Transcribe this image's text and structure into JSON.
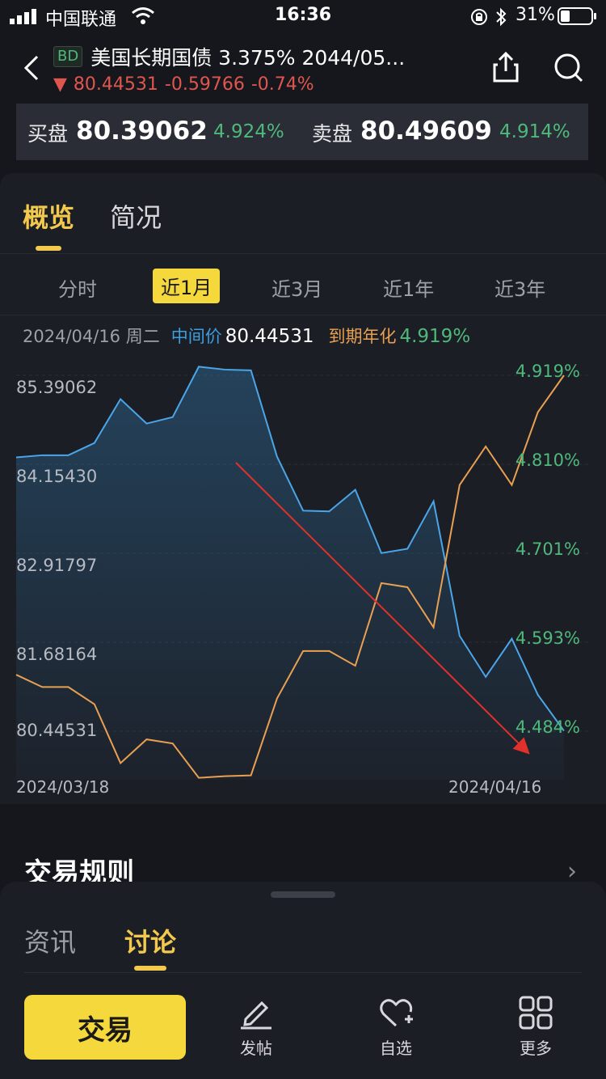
{
  "status_bar": {
    "carrier": "中国联通",
    "time": "16:36",
    "battery": "31%"
  },
  "header": {
    "badge": "BD",
    "title": "美国长期国债 3.375% 2044/05...",
    "arrow": "▼",
    "price": "80.44531",
    "change": "-0.59766",
    "change_pct": "-0.74%",
    "share_icon": "share-icon",
    "search_icon": "search-icon"
  },
  "quote": {
    "bid_label": "买盘",
    "bid_price": "80.39062",
    "bid_yield": "4.924%",
    "ask_label": "卖盘",
    "ask_price": "80.49609",
    "ask_yield": "4.914%"
  },
  "tabs": {
    "overview": "概览",
    "profile": "简况"
  },
  "periods": {
    "intraday": "分时",
    "m1": "近1月",
    "m3": "近3月",
    "y1": "近1年",
    "y3": "近3年"
  },
  "info": {
    "date": "2024/04/16 周二",
    "mid_label": "中间价",
    "mid_value": "80.44531",
    "ytm_label": "到期年化",
    "ytm_value": "4.919%"
  },
  "chart_data": {
    "type": "line",
    "price_ticks": [
      "85.39062",
      "84.15430",
      "82.91797",
      "81.68164",
      "80.44531"
    ],
    "yield_ticks": [
      "4.919%",
      "4.810%",
      "4.701%",
      "4.593%",
      "4.484%"
    ],
    "x_start_label": "2024/03/18",
    "x_end_label": "2024/04/16",
    "price_range": [
      80.44531,
      85.39062
    ],
    "yield_range": [
      4.484,
      4.919
    ],
    "series": [
      {
        "color": "#4aa6e8",
        "axis": "left",
        "values": [
          84.25,
          84.28,
          84.28,
          84.45,
          85.06,
          84.72,
          84.81,
          85.51,
          85.47,
          85.46,
          84.26,
          83.51,
          83.5,
          83.8,
          82.92,
          82.98,
          83.64,
          81.77,
          81.2,
          81.73,
          80.95,
          80.45
        ]
      },
      {
        "color": "#e8a052",
        "axis": "right",
        "values": [
          4.553,
          4.538,
          4.538,
          4.517,
          4.445,
          4.474,
          4.469,
          4.427,
          4.429,
          4.43,
          4.524,
          4.582,
          4.582,
          4.564,
          4.665,
          4.66,
          4.611,
          4.785,
          4.832,
          4.785,
          4.874,
          4.919
        ]
      }
    ],
    "annotation": "red-trend-arrow"
  },
  "rules": {
    "title": "交易规则"
  },
  "sheet": {
    "news": "资讯",
    "discuss": "讨论"
  },
  "bottom": {
    "trade": "交易",
    "post": "发帖",
    "watch": "自选",
    "more": "更多"
  }
}
